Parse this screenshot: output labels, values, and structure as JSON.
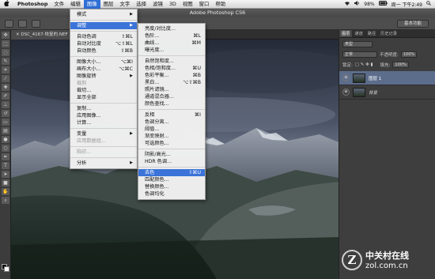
{
  "macbar": {
    "apple": "",
    "items": [
      "Photoshop",
      "文件",
      "编辑",
      "图像",
      "图层",
      "文字",
      "选择",
      "滤镜",
      "3D",
      "视图",
      "窗口",
      "帮助"
    ],
    "active_index": 3,
    "battery": "98%",
    "clock": "周一 下午2:49"
  },
  "window_title": "Adobe Photoshop CS6",
  "document_tab": "DSC_4167-恢复的.NEF",
  "essentials_label": "基本功能",
  "panel": {
    "tabs": [
      "图层",
      "通道",
      "路径",
      "历史记录"
    ],
    "active_tab": 0,
    "kind_label": "类型",
    "mode": "正常",
    "opacity_label": "不透明度:",
    "opacity_value": "100%",
    "lock_label": "锁定:",
    "fill_label": "填充:",
    "fill_value": "100%",
    "layers": [
      {
        "name": "图层 1",
        "selected": true
      },
      {
        "name": "背景",
        "selected": false
      }
    ]
  },
  "image_menu": {
    "items": [
      {
        "label": "模式",
        "arrow": true
      },
      {
        "sep": true
      },
      {
        "label": "调整",
        "arrow": true,
        "highlighted": true
      },
      {
        "sep": true
      },
      {
        "label": "自动色调",
        "shortcut": "⇧⌘L"
      },
      {
        "label": "自动对比度",
        "shortcut": "⌥⇧⌘L"
      },
      {
        "label": "自动颜色",
        "shortcut": "⇧⌘B"
      },
      {
        "sep": true
      },
      {
        "label": "图像大小...",
        "shortcut": "⌥⌘I"
      },
      {
        "label": "画布大小...",
        "shortcut": "⌥⌘C"
      },
      {
        "label": "图像旋转",
        "arrow": true
      },
      {
        "label": "裁剪",
        "disabled": true
      },
      {
        "label": "裁切..."
      },
      {
        "label": "显示全部"
      },
      {
        "sep": true
      },
      {
        "label": "复制..."
      },
      {
        "label": "应用图像..."
      },
      {
        "label": "计算..."
      },
      {
        "sep": true
      },
      {
        "label": "变量",
        "arrow": true
      },
      {
        "label": "应用数据组...",
        "disabled": true
      },
      {
        "sep": true
      },
      {
        "label": "陷印...",
        "disabled": true
      },
      {
        "sep": true
      },
      {
        "label": "分析",
        "arrow": true
      }
    ]
  },
  "adjust_menu": {
    "items": [
      {
        "label": "亮度/对比度..."
      },
      {
        "label": "色阶...",
        "shortcut": "⌘L"
      },
      {
        "label": "曲线...",
        "shortcut": "⌘M"
      },
      {
        "label": "曝光度..."
      },
      {
        "sep": true
      },
      {
        "label": "自然饱和度..."
      },
      {
        "label": "色相/饱和度...",
        "shortcut": "⌘U"
      },
      {
        "label": "色彩平衡...",
        "shortcut": "⌘B"
      },
      {
        "label": "黑白...",
        "shortcut": "⌥⇧⌘B"
      },
      {
        "label": "照片滤镜..."
      },
      {
        "label": "通道混合器..."
      },
      {
        "label": "颜色查找..."
      },
      {
        "sep": true
      },
      {
        "label": "反相",
        "shortcut": "⌘I"
      },
      {
        "label": "色调分离..."
      },
      {
        "label": "阈值..."
      },
      {
        "label": "渐变映射..."
      },
      {
        "label": "可选颜色..."
      },
      {
        "sep": true
      },
      {
        "label": "阴影/高光..."
      },
      {
        "label": "HDR 色调..."
      },
      {
        "sep": true
      },
      {
        "label": "去色",
        "shortcut": "⇧⌘U",
        "highlighted": true
      },
      {
        "label": "匹配颜色..."
      },
      {
        "label": "替换颜色..."
      },
      {
        "label": "色调均化"
      }
    ]
  },
  "watermark": {
    "line1": "中关村在线",
    "line2": "zol.com.cn"
  },
  "colors": {
    "menu_highlight": "#3b73d8",
    "layer_selected": "#5c6d8c"
  }
}
